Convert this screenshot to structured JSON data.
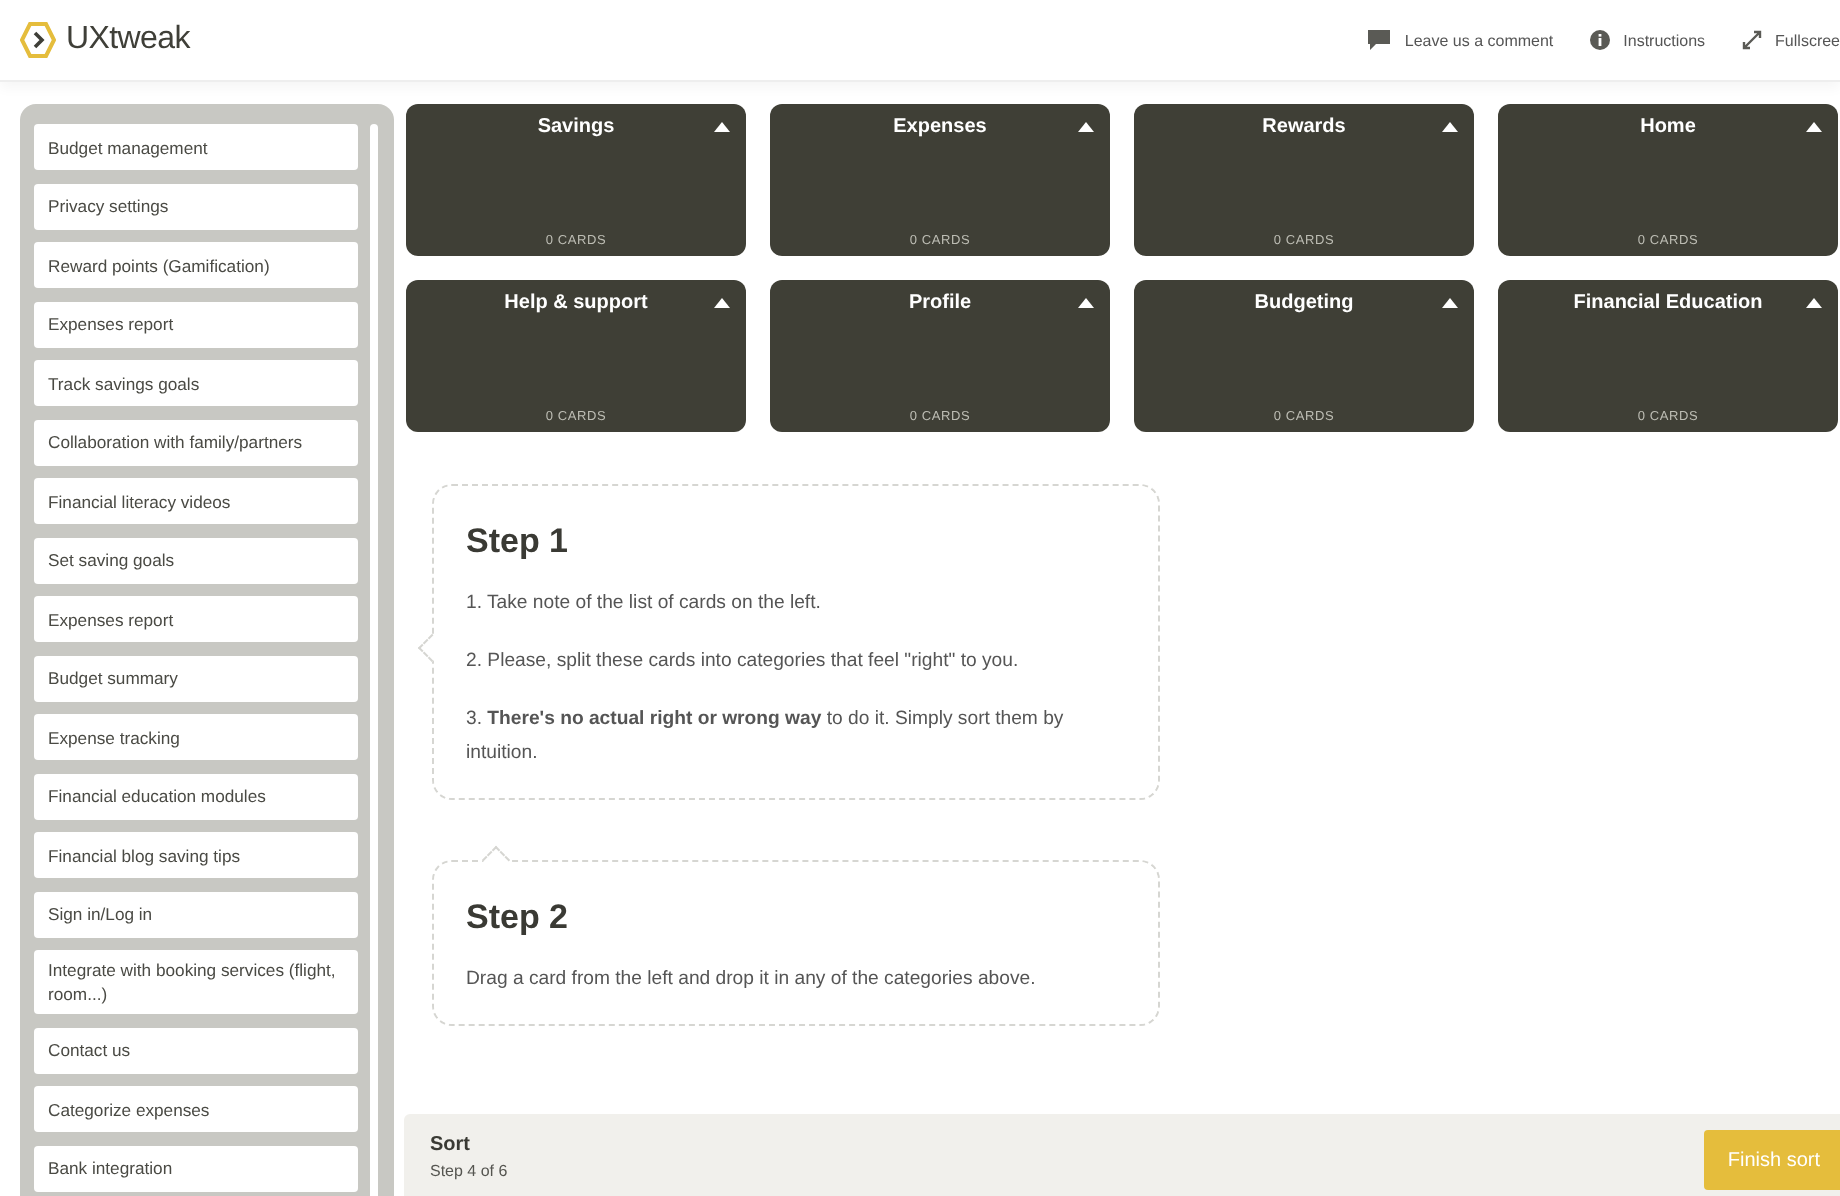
{
  "header": {
    "logo": "UXtweak",
    "actions": [
      {
        "kind": "comment",
        "label": "Leave us a comment"
      },
      {
        "kind": "info",
        "label": "Instructions"
      },
      {
        "kind": "fullscreen",
        "label": "Fullscree"
      }
    ]
  },
  "cards": [
    "Budget management",
    "Privacy settings",
    "Reward points (Gamification)",
    "Expenses report",
    "Track savings goals",
    "Collaboration with family/partners",
    "Financial literacy videos",
    "Set saving goals",
    "Expenses report",
    "Budget summary",
    "Expense tracking",
    "Financial education modules",
    "Financial blog saving tips",
    "Sign in/Log in",
    "Integrate with booking services (flight, room...)",
    "Contact us",
    "Categorize expenses",
    "Bank integration"
  ],
  "categories": [
    {
      "name": "Savings",
      "count": "0 CARDS"
    },
    {
      "name": "Expenses",
      "count": "0 CARDS"
    },
    {
      "name": "Rewards",
      "count": "0 CARDS"
    },
    {
      "name": "Home",
      "count": "0 CARDS"
    },
    {
      "name": "Help & support",
      "count": "0 CARDS"
    },
    {
      "name": "Profile",
      "count": "0 CARDS"
    },
    {
      "name": "Budgeting",
      "count": "0 CARDS"
    },
    {
      "name": "Financial Education",
      "count": "0 CARDS"
    }
  ],
  "steps": [
    {
      "title": "Step 1",
      "kind": "left",
      "paragraphs": [
        "1. Take note of the list of cards on the left.",
        "2. Please, split these cards into categories that feel \"right\" to you.",
        "3. **There's no actual right or wrong way** to do it. Simply sort them by intuition."
      ]
    },
    {
      "title": "Step 2",
      "kind": "top",
      "paragraphs": [
        "Drag a card from the left and drop it in any of the categories above."
      ]
    }
  ],
  "footer": {
    "title": "Sort",
    "subtitle": "Step 4 of 6",
    "button": "Finish sort"
  }
}
